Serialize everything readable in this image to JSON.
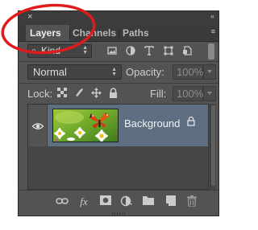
{
  "panel": {
    "close_glyph": "×",
    "collapse_glyph": "‹‹",
    "menu_glyph": "≡",
    "tabs": [
      {
        "label": "Layers",
        "active": true
      },
      {
        "label": "Channels",
        "active": false
      },
      {
        "label": "Paths",
        "active": false
      }
    ]
  },
  "filter": {
    "kind_label": "Kind",
    "icons": [
      "image-filter-icon",
      "adjustment-filter-icon",
      "type-filter-icon",
      "shape-filter-icon",
      "smart-object-filter-icon"
    ]
  },
  "blend": {
    "mode": "Normal",
    "opacity_label": "Opacity:",
    "opacity_value": "100%",
    "fill_label": "Fill:",
    "fill_value": "100%"
  },
  "lock": {
    "label": "Lock:"
  },
  "layers": [
    {
      "name": "Background",
      "visible": true,
      "locked": true,
      "selected": true
    }
  ],
  "bottom_icons": [
    "link-layers-icon",
    "fx-icon",
    "mask-icon",
    "adjustment-layer-icon",
    "group-folder-icon",
    "new-layer-icon",
    "trash-icon"
  ],
  "colors": {
    "panel_bg": "#535353",
    "selected_row": "#5e6f82",
    "highlight_circle": "#e01b1b"
  }
}
